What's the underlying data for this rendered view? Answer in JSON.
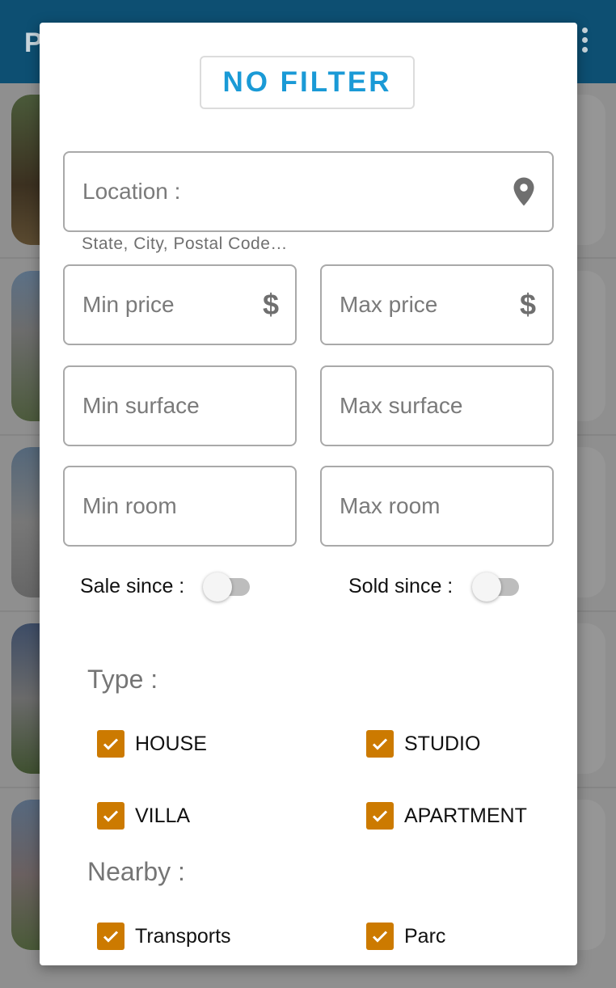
{
  "background": {
    "app_title": "P",
    "menu_icon": "more-vert-icon"
  },
  "dialog": {
    "no_filter_label": "NO FILTER",
    "location": {
      "placeholder": "Location :",
      "helper": "State, City, Postal Code…",
      "icon": "location-pin-icon"
    },
    "min_price": {
      "placeholder": "Min price",
      "suffix": "$"
    },
    "max_price": {
      "placeholder": "Max price",
      "suffix": "$"
    },
    "min_surface": {
      "placeholder": "Min surface"
    },
    "max_surface": {
      "placeholder": "Max surface"
    },
    "min_room": {
      "placeholder": "Min room"
    },
    "max_room": {
      "placeholder": "Max room"
    },
    "sale_since": {
      "label": "Sale since :",
      "on": false
    },
    "sold_since": {
      "label": "Sold since :",
      "on": false
    },
    "type": {
      "label": "Type :",
      "options": [
        {
          "label": "HOUSE",
          "checked": true
        },
        {
          "label": "STUDIO",
          "checked": true
        },
        {
          "label": "VILLA",
          "checked": true
        },
        {
          "label": "APARTMENT",
          "checked": true
        }
      ]
    },
    "nearby": {
      "label": "Nearby :",
      "options": [
        {
          "label": "Transports",
          "checked": true
        },
        {
          "label": "Parc",
          "checked": true
        }
      ]
    }
  },
  "colors": {
    "accent_blue": "#1a9ad6",
    "checkbox_orange": "#cc7a00",
    "app_bar": "#0d4f72"
  }
}
